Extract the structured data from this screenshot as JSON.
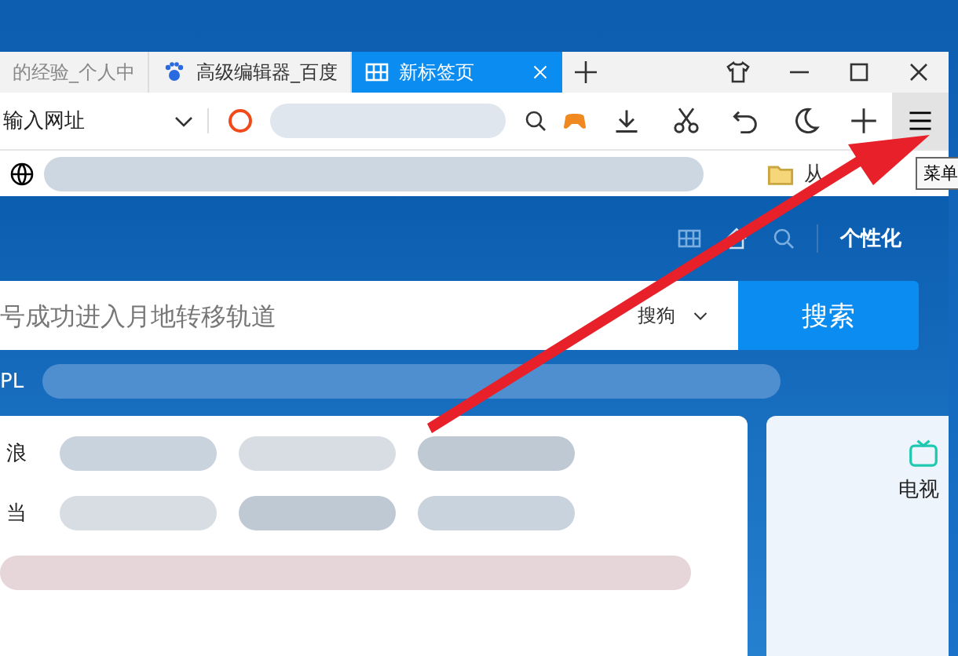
{
  "tabs": [
    {
      "label": "的经验_个人中",
      "kind": "faded",
      "selected": false
    },
    {
      "label": "高级编辑器_百度",
      "kind": "paw",
      "selected": false
    },
    {
      "label": "新标签页",
      "kind": "grid",
      "selected": true
    }
  ],
  "address_bar": {
    "placeholder": "输入网址"
  },
  "bookmarks": {
    "folder_label": "从"
  },
  "tooltip": "菜单",
  "page": {
    "personalize": "个性化",
    "search": {
      "placeholder": "号成功进入月地转移轨道",
      "engine": "搜狗",
      "button": "搜索"
    },
    "hot_label": "PL",
    "sites": [
      "浪",
      "当"
    ],
    "side_card": {
      "label": "电视"
    }
  }
}
